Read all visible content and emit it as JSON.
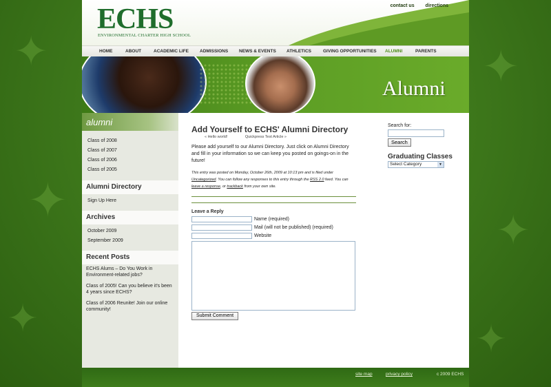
{
  "header": {
    "logo_text": "ECHS",
    "logo_subtitle": "ENVIRONMENTAL CHARTER HIGH SCHOOL",
    "top_links": [
      "contact us",
      "directions"
    ]
  },
  "nav": {
    "items": [
      "HOME",
      "ABOUT",
      "ACADEMIC LIFE",
      "ADMISSIONS",
      "NEWS & EVENTS",
      "ATHLETICS",
      "GIVING OPPORTUNITIES",
      "ALUMNI",
      "PARENTS"
    ],
    "active": "ALUMNI"
  },
  "banner": {
    "title": "Alumni"
  },
  "sidebar": {
    "alumni_heading": "alumni",
    "alumni_links": [
      "Class of 2008",
      "Class of 2007",
      "Class of 2006",
      "Class of 2005"
    ],
    "directory_title": "Alumni Directory",
    "directory_links": [
      "Sign Up Here"
    ],
    "archives_title": "Archives",
    "archives_links": [
      "October 2009",
      "September 2009"
    ],
    "recent_title": "Recent Posts",
    "recent_posts": [
      "ECHS Alums – Do You Work in Environment-related jobs?",
      "Class of 2005! Can you believe it's been 4 years since ECHS?",
      "Class of 2006 Reunite! Join our online community!"
    ]
  },
  "main": {
    "title": "Add Yourself to ECHS' Alumni Directory",
    "prev_link": "« Hello world!",
    "next_link": "Quickpress Test Article »",
    "body": "Please add yourself to our Alumni Directory.  Just click on Alumni Directory and fill in your information so we can keep you posted on goings-on in the future!",
    "meta": {
      "part1": "This entry was posted on Monday, October 26th, 2009 at 10:13 pm and is filed under ",
      "category": "Uncategorized",
      "part2": ". You can follow any responses to this entry through the ",
      "rss": "RSS 2.0",
      "part3": " feed. You can ",
      "respond": "leave a response",
      "part4": ", or ",
      "trackback": "trackback",
      "part5": " from your own site."
    },
    "reply_title": "Leave a Reply",
    "fields": [
      "Name (required)",
      "Mail (will not be published) (required)",
      "Website"
    ],
    "submit_label": "Submit Comment"
  },
  "right": {
    "search_label": "Search for:",
    "search_button": "Search",
    "grad_title": "Graduating Classes",
    "grad_select": "Select Category"
  },
  "footer": {
    "site_map": "site map",
    "privacy": "privacy policy",
    "copyright": "c 2009 ECHS"
  },
  "colors": {
    "brand_green": "#1f6d2c",
    "accent_green": "#4d8b18",
    "background": "#3f7a1c"
  }
}
